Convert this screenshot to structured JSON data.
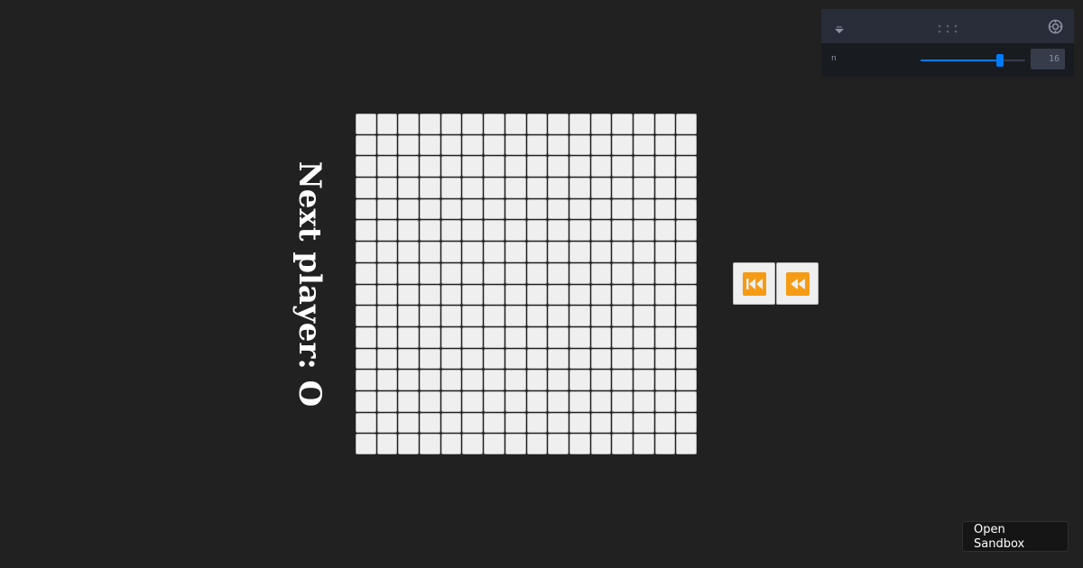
{
  "status": {
    "text": "Next player: O"
  },
  "board": {
    "size": 16,
    "cells": []
  },
  "history": {
    "buttons": [
      {
        "name": "history-first-button",
        "icon": "skip-to-start-icon"
      },
      {
        "name": "history-back-button",
        "icon": "rewind-icon"
      }
    ]
  },
  "controls": {
    "header_icons": [
      "collapse-icon",
      "drag-handle-icon",
      "settings-icon"
    ],
    "n_label": "n",
    "n_value": "16",
    "n_fraction": 0.76
  },
  "sandbox": {
    "label": "Open Sandbox"
  },
  "colors": {
    "background": "#212121",
    "cell": "#efefef",
    "accent": "#f59b14",
    "slider": "#007bff"
  }
}
